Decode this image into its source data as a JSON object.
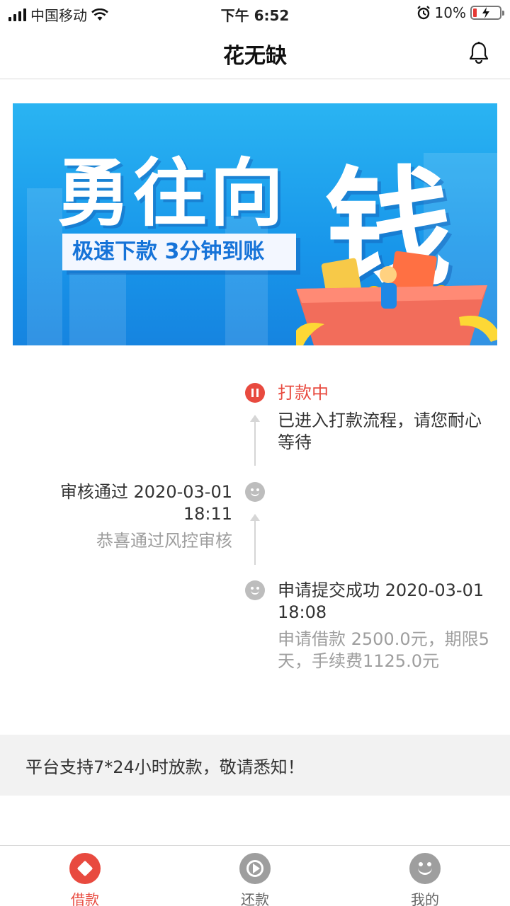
{
  "status_bar": {
    "carrier": "中国移动",
    "time": "下午 6:52",
    "battery": "10%"
  },
  "header": {
    "title": "花无缺",
    "bell_icon": "bell-icon"
  },
  "banner": {
    "headline": "勇往向",
    "big_char": "钱",
    "subtitle": "极速下款  3分钟到账"
  },
  "timeline": {
    "steps": [
      {
        "title": "打款中",
        "desc": "已进入打款流程，请您耐心等待",
        "desc_line1": "已进入打款流程，请您耐心",
        "desc_line2": "等待",
        "icon": "pause-icon",
        "color": "#e84a3f"
      },
      {
        "title_line1": "审核通过 2020-03-01",
        "title_line2": "18:11",
        "desc": "恭喜通过风控审核",
        "icon": "smiley-icon"
      },
      {
        "title_line1": "申请提交成功 2020-03-01",
        "title_line2": "18:08",
        "desc_line1": "申请借款 2500.0元，期限5",
        "desc_line2": "天，手续费1125.0元",
        "icon": "smiley-icon"
      }
    ]
  },
  "loan": {
    "amount": 2500.0,
    "term_days": 5,
    "fee": 1125.0
  },
  "notice": "平台支持7*24小时放款，敬请悉知！",
  "tabs": [
    {
      "label": "借款",
      "icon": "diamond-icon",
      "active": true
    },
    {
      "label": "还款",
      "icon": "play-icon",
      "active": false
    },
    {
      "label": "我的",
      "icon": "smiley-icon",
      "active": false
    }
  ],
  "colors": {
    "accent": "#e84a3f",
    "inactive": "#9e9e9e"
  }
}
